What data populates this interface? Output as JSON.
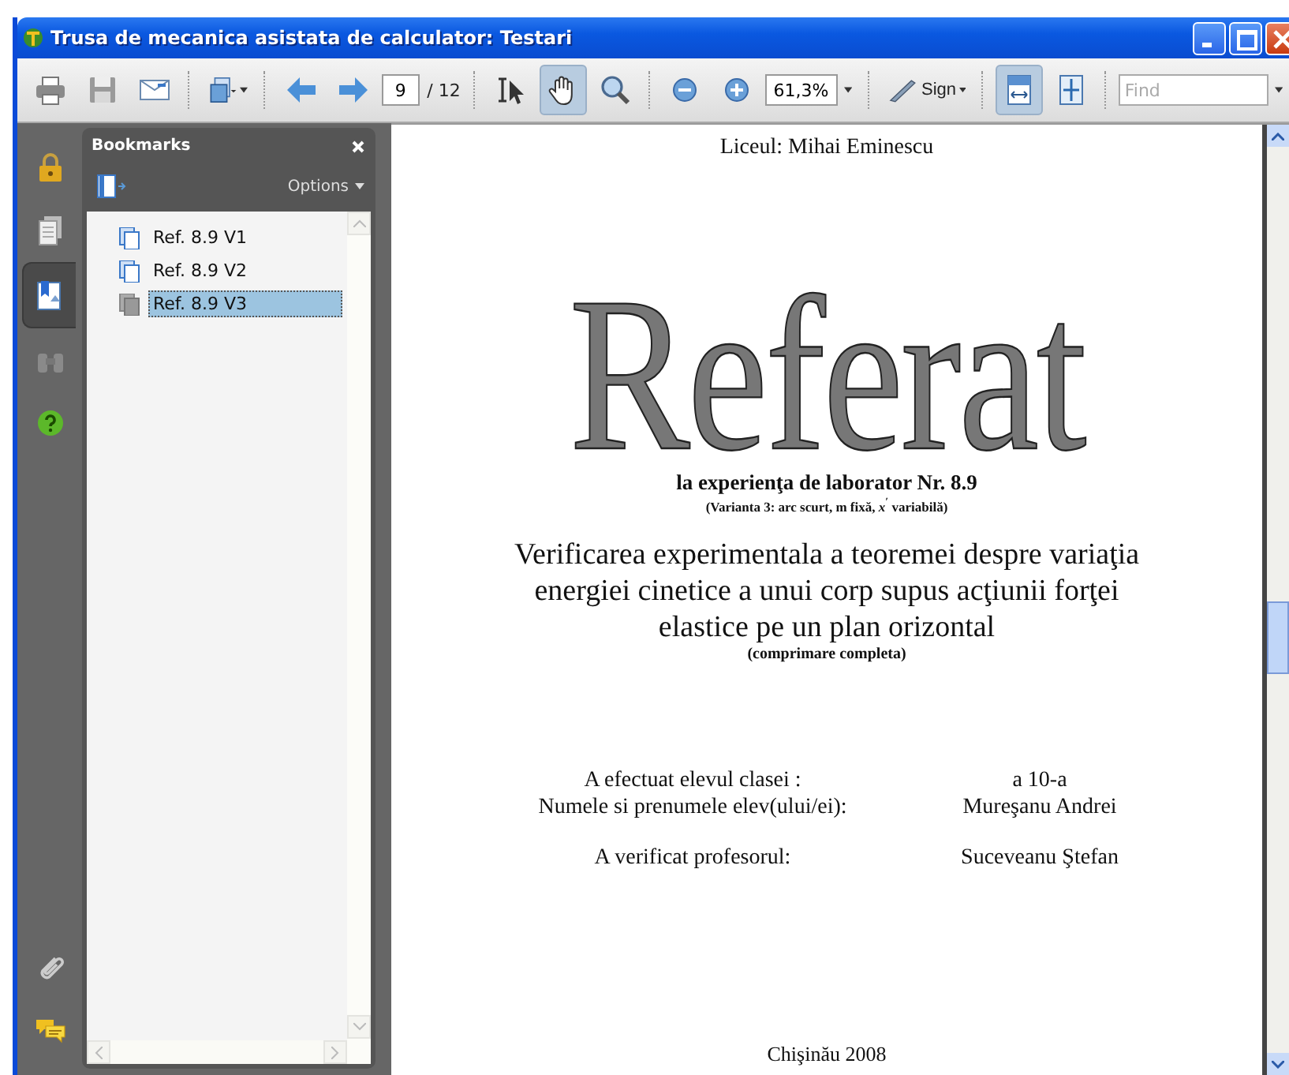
{
  "window": {
    "title": "Trusa de mecanica asistata de calculator: Testari"
  },
  "toolbar": [
    {
      "kind": "print",
      "selected": false
    },
    {
      "kind": "save",
      "selected": false
    },
    {
      "kind": "email",
      "selected": false
    },
    {
      "kind": "pages",
      "selected": false
    },
    {
      "kind": "prev",
      "selected": false
    },
    {
      "kind": "next",
      "selected": false
    },
    {
      "kind": "page",
      "value": "9",
      "total": "/ 12"
    },
    {
      "kind": "select",
      "selected": false
    },
    {
      "kind": "hand",
      "selected": true
    },
    {
      "kind": "marquee",
      "selected": false
    },
    {
      "kind": "zoom-out",
      "selected": false
    },
    {
      "kind": "zoom-in",
      "selected": false
    },
    {
      "kind": "zoom",
      "value": "61,3%"
    },
    {
      "kind": "sign",
      "label": "Sign"
    },
    {
      "kind": "fit-width",
      "selected": true
    },
    {
      "kind": "fit-page",
      "selected": false
    },
    {
      "kind": "find",
      "placeholder": "Find"
    }
  ],
  "rail": {
    "top": [
      {
        "kind": "lock",
        "selected": false
      },
      {
        "kind": "pages",
        "selected": false
      },
      {
        "kind": "bookmarks",
        "selected": true
      },
      {
        "kind": "search",
        "selected": false
      },
      {
        "kind": "help",
        "selected": false
      }
    ],
    "bottom": [
      {
        "kind": "attach",
        "selected": false
      },
      {
        "kind": "comments",
        "selected": false
      }
    ]
  },
  "bookmarks": {
    "title": "Bookmarks",
    "options": "Options",
    "items": [
      {
        "label": "Ref. 8.9 V1",
        "selected": false
      },
      {
        "label": "Ref. 8.9 V2",
        "selected": false
      },
      {
        "label": "Ref. 8.9 V3",
        "selected": true
      }
    ]
  },
  "document": {
    "school": "Liceul: Mihai Eminescu",
    "title": "Referat",
    "subtitle": "la experienţa de laborator Nr. 8.9",
    "variant": "(Varianta 3: arc scurt, m fixă,  *x*$^{′}$  variabilă)",
    "heading": [
      "Verificarea experimentala a teoremei despre variaţia",
      "energiei cinetice a unui corp supus acţiunii forţei",
      "elastice  pe un plan orizontal"
    ],
    "note": "(comprimare completa)",
    "fields": [
      {
        "label": "A efectuat elevul clasei :",
        "value": "a 10-a"
      },
      {
        "label": "Numele si prenumele elev(ului/ei):",
        "value": "Mureşanu Andrei"
      },
      {
        "label": "A verificat profesorul:",
        "value": "Suceveanu Ştefan"
      }
    ],
    "footer": "Chişinău 2008"
  }
}
